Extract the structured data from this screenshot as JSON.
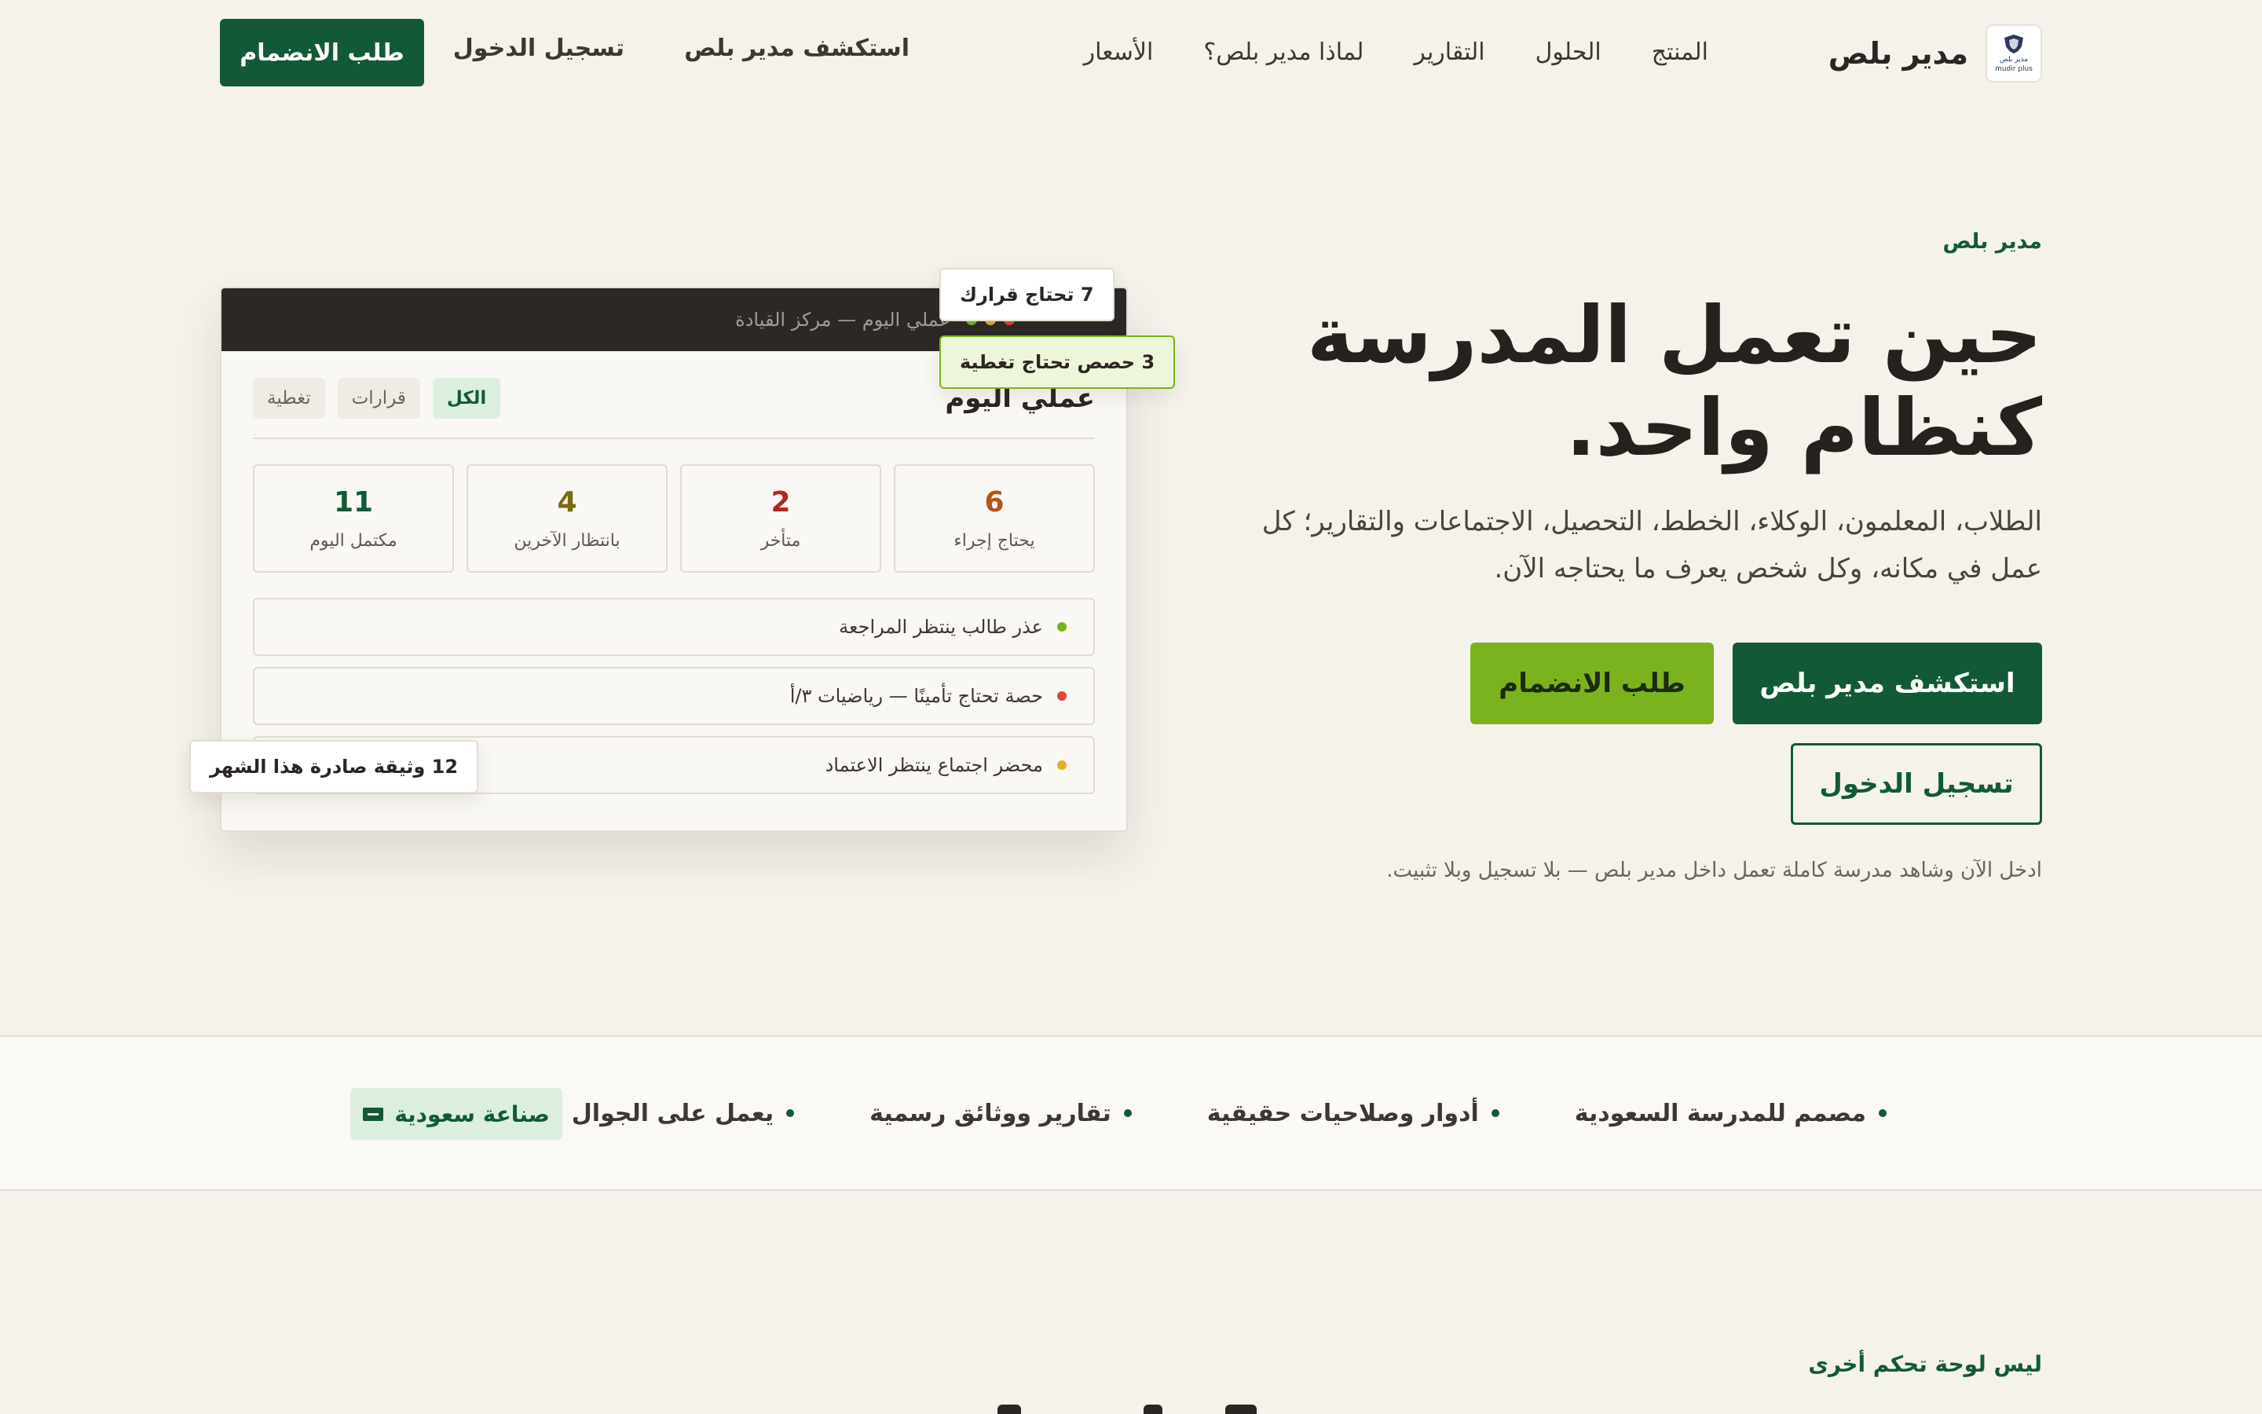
{
  "nav": {
    "brand": "مدير بلص",
    "brand_logo_small": "مدير بلص",
    "brand_logo_tiny": "mudir plus",
    "links": [
      "المنتج",
      "الحلول",
      "التقارير",
      "لماذا مدير بلص؟",
      "الأسعار"
    ],
    "explore": "استكشف مدير بلص",
    "login": "تسجيل الدخول",
    "join": "طلب الانضمام"
  },
  "hero": {
    "eyebrow": "مدير بلص",
    "title_line1": "حين تعمل المدرسة",
    "title_line2": "كنظام واحد.",
    "subtitle": "الطلاب، المعلمون، الوكلاء، الخطط، التحصيل، الاجتماعات والتقارير؛ كل عمل في مكانه، وكل شخص يعرف ما يحتاجه الآن.",
    "btn_explore": "استكشف مدير بلص",
    "btn_join": "طلب الانضمام",
    "btn_login": "تسجيل الدخول",
    "note": "ادخل الآن وشاهد مدرسة كاملة تعمل داخل مدير بلص — بلا تسجيل وبلا تثبيت."
  },
  "dashboard": {
    "bar_title": "عملي اليوم — مركز القيادة",
    "title": "عملي اليوم",
    "filters": [
      "الكل",
      "قرارات",
      "تغطية"
    ],
    "stats": [
      {
        "value": "6",
        "label": "يحتاج إجراء",
        "color": "#b5541b"
      },
      {
        "value": "2",
        "label": "متأخر",
        "color": "#b3261e"
      },
      {
        "value": "4",
        "label": "بانتظار الآخرين",
        "color": "#7a6a10"
      },
      {
        "value": "11",
        "label": "مكتمل اليوم",
        "color": "#125a37"
      }
    ],
    "rows": [
      {
        "text": "عذر طالب ينتظر المراجعة",
        "color": "#7bb31e"
      },
      {
        "text": "حصة تحتاج تأمينًا — رياضيات ٣/أ",
        "color": "#e0443a"
      },
      {
        "text": "محضر اجتماع ينتظر الاعتماد",
        "color": "#e0b21e"
      }
    ],
    "chip_decisions": "7 تحتاج قرارك",
    "chip_coverage": "3 حصص تحتاج تغطية",
    "chip_docs": "12 وثيقة صادرة هذا الشهر"
  },
  "strip": {
    "features": [
      "مصمم للمدرسة السعودية",
      "أدوار وصلاحيات حقيقية",
      "تقارير ووثائق رسمية",
      "يعمل على الجوال والحاسب"
    ],
    "saudi_badge": "صناعة سعودية"
  },
  "next": {
    "eyebrow": "ليس لوحة تحكم أخرى"
  },
  "colors": {
    "primary": "#125a37",
    "accent": "#7bb31e",
    "background": "#f5f2ec"
  }
}
